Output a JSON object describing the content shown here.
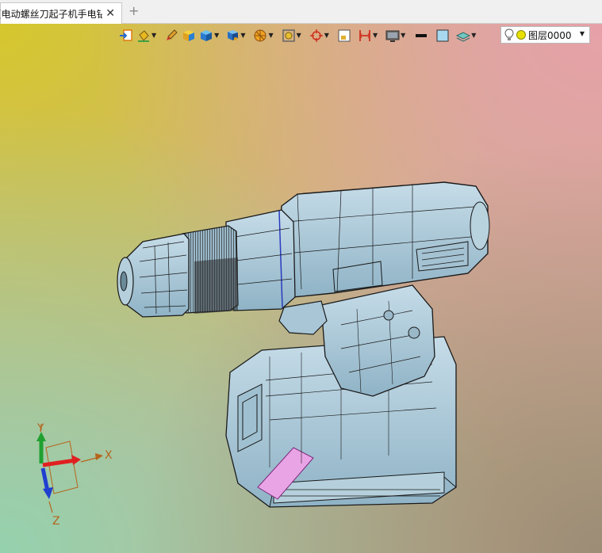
{
  "tab": {
    "title": "[电动螺丝刀起子机手电钻]",
    "close_glyph": "✕",
    "add_glyph": "+"
  },
  "toolbar": {
    "items": [
      {
        "icon": "import-icon",
        "has_dropdown": false
      },
      {
        "icon": "paint-bucket-icon",
        "has_dropdown": true
      },
      {
        "icon": "brush-icon",
        "has_dropdown": false
      },
      {
        "icon": "shaded-cube-icon",
        "has_dropdown": false
      },
      {
        "icon": "render-style-icon",
        "has_dropdown": true
      },
      {
        "icon": "view-orientation-icon",
        "has_dropdown": true
      },
      {
        "icon": "section-view-icon",
        "has_dropdown": true
      },
      {
        "icon": "fit-view-icon",
        "has_dropdown": true
      },
      {
        "icon": "focus-target-icon",
        "has_dropdown": true
      },
      {
        "icon": "clipping-box-icon",
        "has_dropdown": false
      },
      {
        "icon": "measure-icon",
        "has_dropdown": true
      },
      {
        "icon": "display-monitor-icon",
        "has_dropdown": true
      },
      {
        "icon": "line-color-icon",
        "has_dropdown": false
      },
      {
        "icon": "face-color-icon",
        "has_dropdown": false
      },
      {
        "icon": "layer-stack-icon",
        "has_dropdown": true
      }
    ]
  },
  "layer": {
    "label": "图层0000"
  },
  "triad": {
    "x_label": "X",
    "y_label": "Y",
    "z_label": "Z"
  },
  "colors": {
    "model_fill": "#a9c8d8",
    "model_edge": "#1a1a1a",
    "highlight_pink": "#e79be6",
    "axis_x": "#e02020",
    "axis_y": "#20a030",
    "axis_z": "#2040d0",
    "axis_label": "#b5651d"
  }
}
